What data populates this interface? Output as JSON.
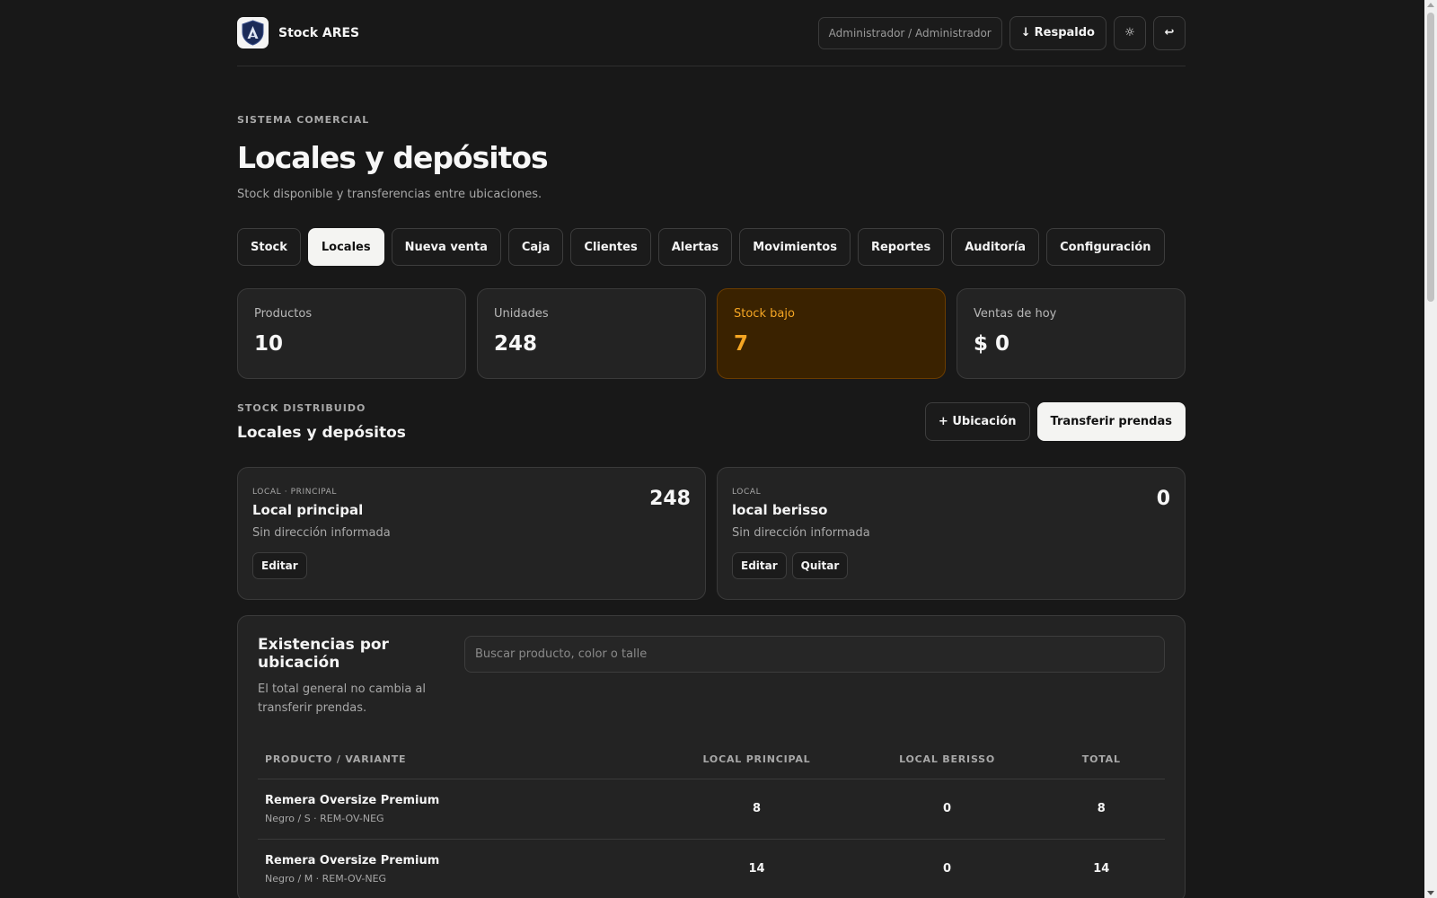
{
  "app": {
    "name": "Stock ARES"
  },
  "header": {
    "user": "Administrador / Administrador",
    "backup_label": "Respaldo",
    "backup_icon": "↓",
    "theme_icon": "☼",
    "logout_icon": "↩"
  },
  "hero": {
    "eyebrow": "SISTEMA COMERCIAL",
    "title": "Locales y depósitos",
    "subtitle": "Stock disponible y transferencias entre ubicaciones."
  },
  "tabs": [
    {
      "label": "Stock"
    },
    {
      "label": "Locales",
      "active": true
    },
    {
      "label": "Nueva venta"
    },
    {
      "label": "Caja"
    },
    {
      "label": "Clientes"
    },
    {
      "label": "Alertas"
    },
    {
      "label": "Movimientos"
    },
    {
      "label": "Reportes"
    },
    {
      "label": "Auditoría"
    },
    {
      "label": "Configuración"
    }
  ],
  "stats": [
    {
      "label": "Productos",
      "value": "10"
    },
    {
      "label": "Unidades",
      "value": "248"
    },
    {
      "label": "Stock bajo",
      "value": "7",
      "accent": "#f5a623"
    },
    {
      "label": "Ventas de hoy",
      "value": "$ 0"
    }
  ],
  "distributed": {
    "eyebrow": "STOCK DISTRIBUIDO",
    "title": "Locales y depósitos",
    "add_location": "+ Ubicación",
    "transfer": "Transferir prendas"
  },
  "locations": [
    {
      "type": "LOCAL · PRINCIPAL",
      "name": "Local principal",
      "address": "Sin dirección informada",
      "count": "248",
      "edit": "Editar"
    },
    {
      "type": "LOCAL",
      "name": "local berisso",
      "address": "Sin dirección informada",
      "count": "0",
      "edit": "Editar",
      "remove": "Quitar"
    }
  ],
  "stock_table": {
    "title": "Existencias por ubicación",
    "description": "El total general no cambia al transferir prendas.",
    "search_placeholder": "Buscar producto, color o talle",
    "columns": [
      "PRODUCTO / VARIANTE",
      "LOCAL PRINCIPAL",
      "LOCAL BERISSO",
      "TOTAL"
    ],
    "rows": [
      {
        "product": "Remera Oversize Premium",
        "variant": "Negro / S · REM-OV-NEG",
        "principal": "8",
        "berisso": "0",
        "total": "8"
      },
      {
        "product": "Remera Oversize Premium",
        "variant": "Negro / M · REM-OV-NEG",
        "principal": "14",
        "berisso": "0",
        "total": "14"
      }
    ]
  },
  "colors": {
    "background": "#181818",
    "card": "#232323",
    "warning_bg": "#3a2200",
    "warning_text": "#f5a623",
    "logo_shield": "#1b2b58"
  }
}
